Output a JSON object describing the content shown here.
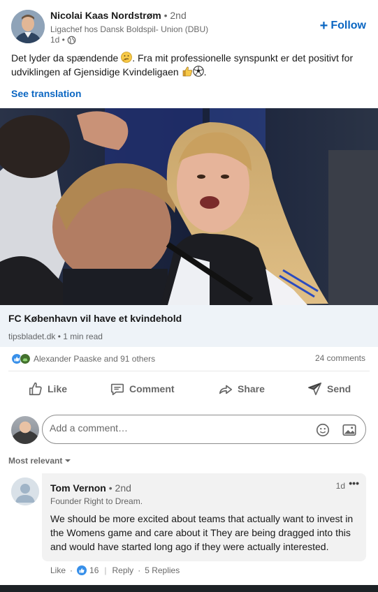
{
  "author": {
    "name": "Nicolai Kaas Nordstrøm",
    "degree": "• 2nd",
    "headline": "Ligachef hos Dansk Boldspil- Union (DBU)",
    "time": "1d •",
    "follow_label": "Follow"
  },
  "post": {
    "text_part1": "Det lyder da spændende ",
    "text_part2": ". Fra mit professionelle synspunkt er det positivt for udviklingen af Gjensidige Kvindeligaen ",
    "text_part3": ".",
    "see_translation": "See translation"
  },
  "article": {
    "title": "FC København vil have et kvindehold",
    "source": "tipsbladet.dk • 1 min read"
  },
  "social": {
    "reactors": "Alexander Paaske and 91 others",
    "comments": "24 comments"
  },
  "actions": {
    "like": "Like",
    "comment": "Comment",
    "share": "Share",
    "send": "Send"
  },
  "comment_box": {
    "placeholder": "Add a comment…"
  },
  "sort": {
    "label": "Most relevant"
  },
  "comments": [
    {
      "name": "Tom Vernon",
      "degree": "• 2nd",
      "headline": "Founder Right to Dream.",
      "time": "1d",
      "more": "•••",
      "body": "We should be more excited about teams that actually want to invest in the Womens game and care about it They are being dragged into this and would have started long ago if they were actually interested.",
      "like_label": "Like",
      "like_count": "16",
      "reply_label": "Reply",
      "replies_label": "5 Replies"
    }
  ],
  "colors": {
    "accent": "#0a66c2",
    "bubble": "#f2f2f2",
    "article_card": "#eef3f8"
  }
}
